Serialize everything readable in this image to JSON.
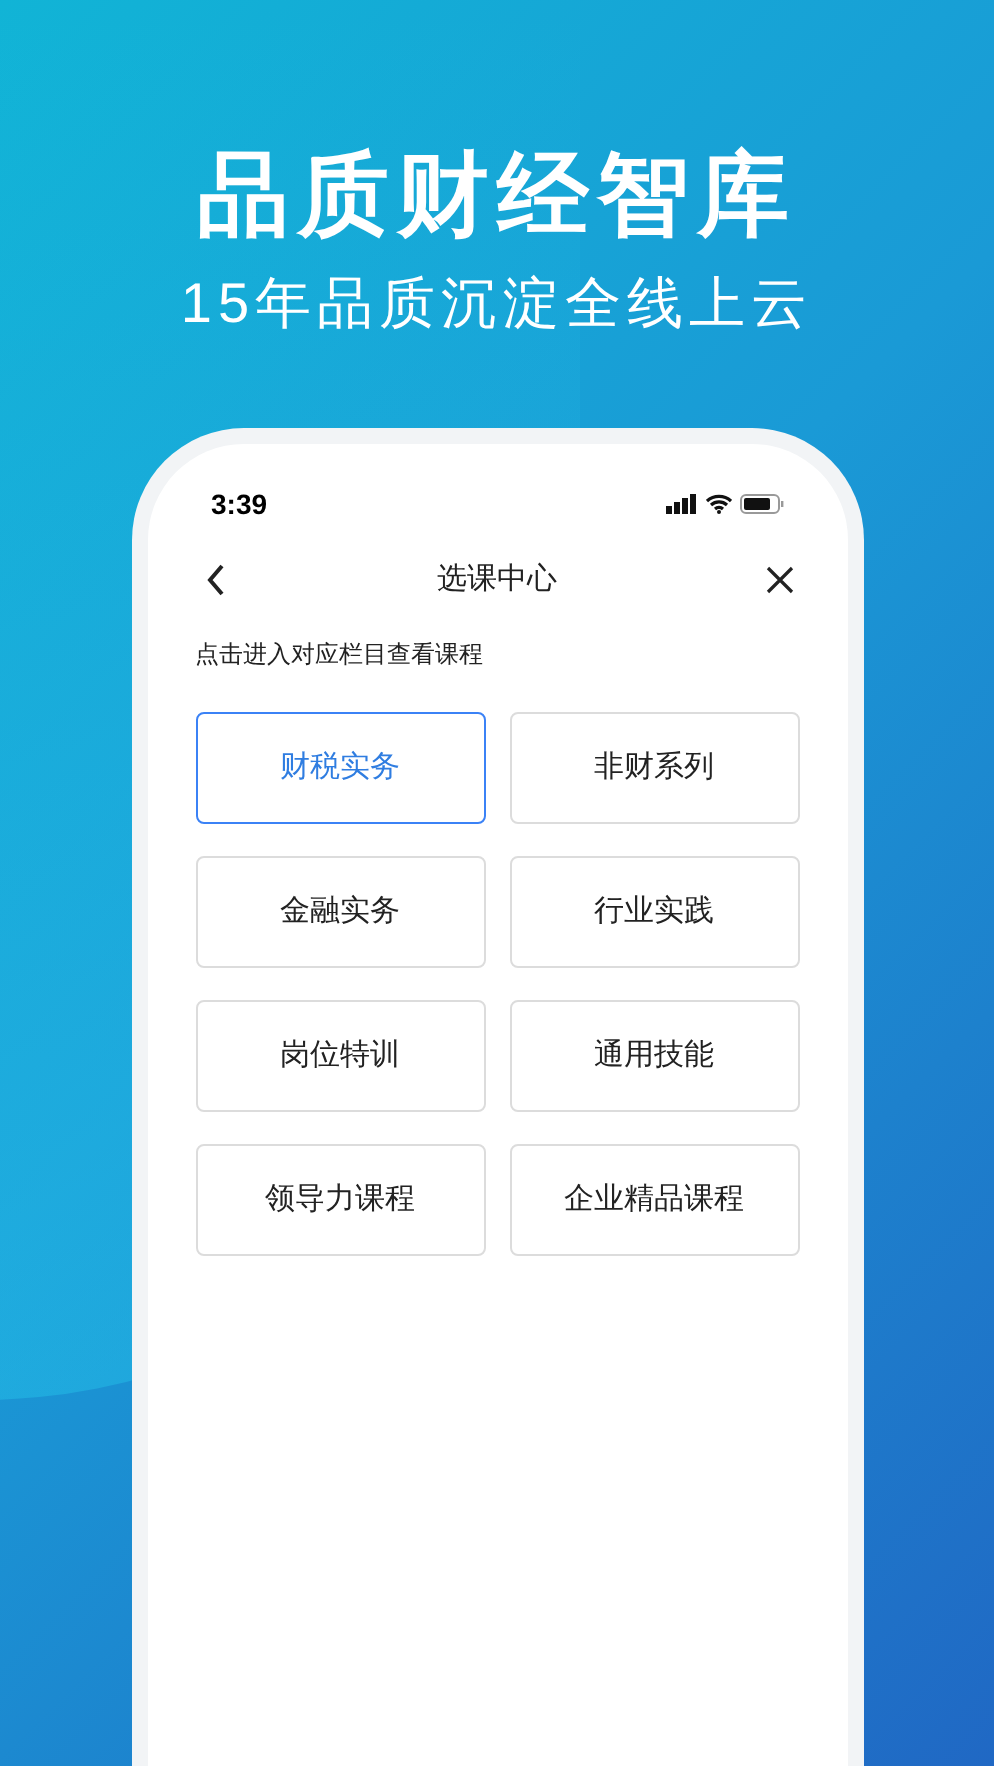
{
  "headline": "品质财经智库",
  "subheadline": "15年品质沉淀全线上云",
  "status_bar": {
    "time": "3:39"
  },
  "nav": {
    "title": "选课中心"
  },
  "hint": "点击进入对应栏目查看课程",
  "categories": [
    {
      "label": "财税实务",
      "selected": true
    },
    {
      "label": "非财系列",
      "selected": false
    },
    {
      "label": "金融实务",
      "selected": false
    },
    {
      "label": "行业实践",
      "selected": false
    },
    {
      "label": "岗位特训",
      "selected": false
    },
    {
      "label": "通用技能",
      "selected": false
    },
    {
      "label": "领导力课程",
      "selected": false
    },
    {
      "label": "企业精品课程",
      "selected": false
    }
  ]
}
